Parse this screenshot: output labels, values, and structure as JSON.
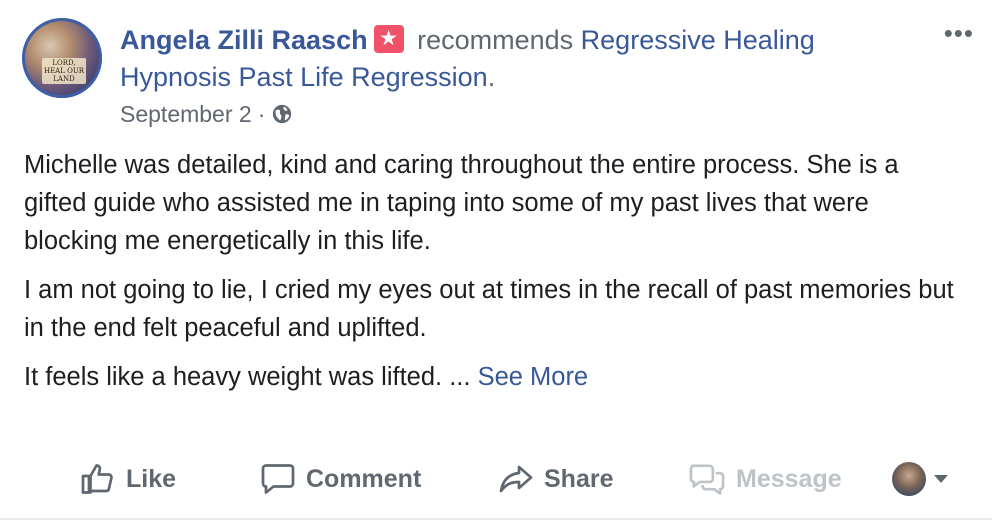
{
  "post": {
    "author": "Angela Zilli Raasch",
    "recommends_word": "recommends",
    "page_name": "Regressive Healing Hypnosis Past Life Regression",
    "period": ".",
    "date": "September 2",
    "separator": "·",
    "icons": {
      "more": "more-horizontal-icon",
      "recommendation": "recommendation-star-icon",
      "privacy": "globe-icon"
    },
    "avatar_caption": "LORD, HEAL OUR LAND",
    "paragraphs": [
      "Michelle was detailed, kind and caring throughout the entire process. She is a gifted guide who assisted me in taping into some of my past lives that were blocking me energetically in this life.",
      "I am not going to lie, I cried my eyes out at times in the recall of past memories but in the end felt peaceful and uplifted."
    ],
    "last_line": "It feels like a heavy weight was lifted. ...",
    "see_more": "See More"
  },
  "actions": {
    "like": "Like",
    "comment": "Comment",
    "share": "Share",
    "message": "Message"
  },
  "colors": {
    "link": "#385898",
    "muted": "#606770",
    "badge": "#f25268",
    "disabled": "#bec3c9"
  }
}
